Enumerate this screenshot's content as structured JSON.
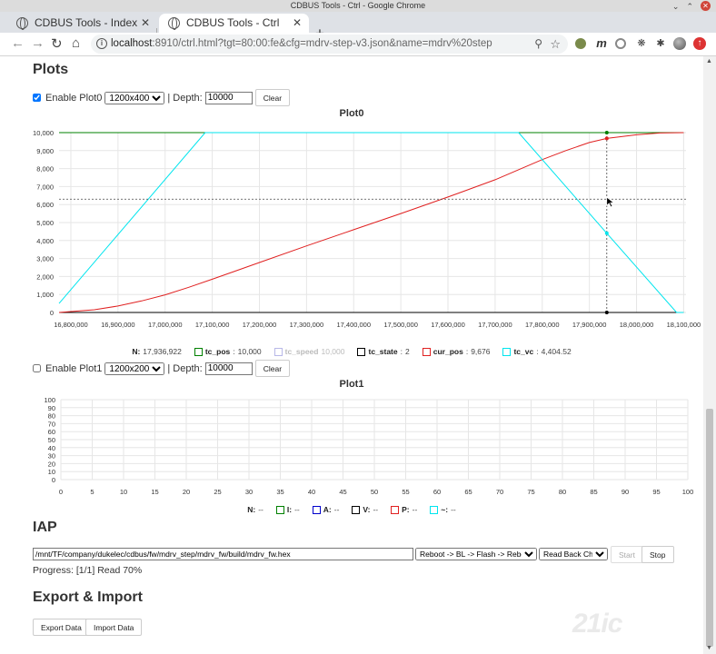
{
  "window": {
    "title": "CDBUS Tools - Ctrl - Google Chrome"
  },
  "tabs": [
    {
      "label": "CDBUS Tools - Index"
    },
    {
      "label": "CDBUS Tools - Ctrl"
    }
  ],
  "address": {
    "host": "localhost",
    "path": ":8910/ctrl.html?tgt=80:00:fe&cfg=mdrv-step-v3.json&name=mdrv%20step"
  },
  "plots_heading": "Plots",
  "plot0_controls": {
    "enable_label": "Enable Plot0",
    "size": "1200x400",
    "depth_label": "| Depth:",
    "depth": "10000",
    "clear_label": "Clear"
  },
  "plot1_controls": {
    "enable_label": "Enable Plot1",
    "size": "1200x200",
    "depth_label": "| Depth:",
    "depth": "10000",
    "clear_label": "Clear"
  },
  "iap": {
    "heading": "IAP",
    "path": "/mnt/TF/company/dukelec/cdbus/fw/mdrv_step/mdrv_fw/build/mdrv_fw.hex",
    "action": "Reboot -> BL -> Flash -> Reboot",
    "check": "Read Back Check",
    "start_label": "Start",
    "stop_label": "Stop",
    "progress": "Progress: [1/1] Read 70%"
  },
  "export": {
    "heading": "Export & Import",
    "export_label": "Export Data",
    "import_label": "Import Data"
  },
  "watermark": "21ic",
  "colors": {
    "green": "#008000",
    "red": "#e02020",
    "cyan": "#00e5ee",
    "faded": "#b8b8e8",
    "black": "#000000",
    "blue": "#0000cc"
  },
  "chart_data": [
    {
      "type": "line",
      "title": "Plot0",
      "xlim": [
        16775000,
        18105000
      ],
      "ylim": [
        0,
        10000
      ],
      "x_ticks": [
        16800000,
        16900000,
        17000000,
        17100000,
        17200000,
        17300000,
        17400000,
        17500000,
        17600000,
        17700000,
        17800000,
        17900000,
        18000000,
        18100000
      ],
      "x_tick_labels": [
        "16,800,000",
        "16,900,000",
        "17,000,000",
        "17,100,000",
        "17,200,000",
        "17,300,000",
        "17,400,000",
        "17,500,000",
        "17,600,000",
        "17,700,000",
        "17,800,000",
        "17,900,000",
        "18,000,000",
        "18,100,000"
      ],
      "y_ticks": [
        0,
        1000,
        2000,
        3000,
        4000,
        5000,
        6000,
        7000,
        8000,
        9000,
        10000
      ],
      "y_tick_labels": [
        "0",
        "1,000",
        "2,000",
        "3,000",
        "4,000",
        "5,000",
        "6,000",
        "7,000",
        "8,000",
        "9,000",
        "10,000"
      ],
      "grid": true,
      "cursor": {
        "x": 17936922,
        "y": 6300
      },
      "legend_n": {
        "label": "N:",
        "value": "17,936,922"
      },
      "series": [
        {
          "name": "tc_pos",
          "value": "10,000",
          "color": "#008000",
          "x": [
            16775000,
            18100000
          ],
          "y": [
            10000,
            10000
          ]
        },
        {
          "name": "tc_speed",
          "value": "10,000",
          "color": "#b8b8e8",
          "faded": true,
          "x": [],
          "y": []
        },
        {
          "name": "tc_state",
          "value": "2",
          "color": "#000000",
          "x": [
            16775000,
            18100000
          ],
          "y": [
            0,
            0
          ]
        },
        {
          "name": "cur_pos",
          "value": "9,676",
          "color": "#e02020",
          "x": [
            16775000,
            16850000,
            16900000,
            16950000,
            17000000,
            17050000,
            17100000,
            17200000,
            17300000,
            17400000,
            17500000,
            17600000,
            17700000,
            17800000,
            17850000,
            17900000,
            17936922,
            18000000,
            18050000,
            18100000
          ],
          "y": [
            0,
            150,
            360,
            640,
            980,
            1400,
            1850,
            2780,
            3700,
            4600,
            5500,
            6420,
            7380,
            8500,
            9000,
            9450,
            9676,
            9880,
            9980,
            10000
          ]
        },
        {
          "name": "tc_vc",
          "value": "4,404.52",
          "color": "#00e5ee",
          "x": [
            16775000,
            17085000,
            17750000,
            17936922,
            18085000,
            18100000
          ],
          "y": [
            500,
            10000,
            10000,
            4404.52,
            0,
            0
          ]
        }
      ]
    },
    {
      "type": "line",
      "title": "Plot1",
      "xlim": [
        0,
        100
      ],
      "ylim": [
        0,
        100
      ],
      "x_ticks": [
        0,
        5,
        10,
        15,
        20,
        25,
        30,
        35,
        40,
        45,
        50,
        55,
        60,
        65,
        70,
        75,
        80,
        85,
        90,
        95,
        100
      ],
      "x_tick_labels": [
        "0",
        "5",
        "10",
        "15",
        "20",
        "25",
        "30",
        "35",
        "40",
        "45",
        "50",
        "55",
        "60",
        "65",
        "70",
        "75",
        "80",
        "85",
        "90",
        "95",
        "100"
      ],
      "y_ticks": [
        0,
        10,
        20,
        30,
        40,
        50,
        60,
        70,
        80,
        90,
        100
      ],
      "y_tick_labels": [
        "0",
        "10",
        "20",
        "30",
        "40",
        "50",
        "60",
        "70",
        "80",
        "90",
        "100"
      ],
      "grid": true,
      "legend_n": {
        "label": "N:",
        "value": "--"
      },
      "series": [
        {
          "name": "I:",
          "value": "--",
          "color": "#008000"
        },
        {
          "name": "A:",
          "value": "--",
          "color": "#0000cc"
        },
        {
          "name": "V:",
          "value": "--",
          "color": "#000000"
        },
        {
          "name": "P:",
          "value": "--",
          "color": "#e02020"
        },
        {
          "name": "~:",
          "value": "--",
          "color": "#00e5ee"
        }
      ]
    }
  ]
}
